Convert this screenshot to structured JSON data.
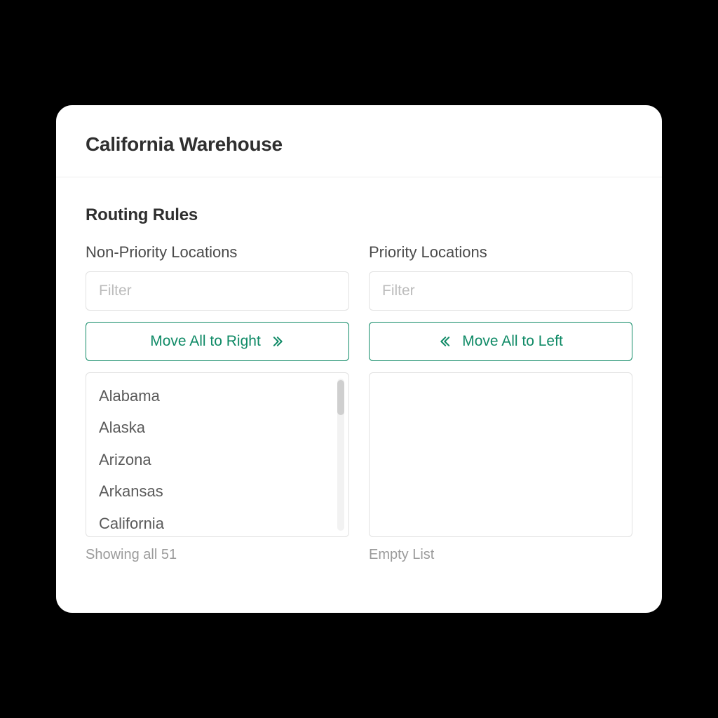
{
  "header": {
    "title": "California Warehouse"
  },
  "section": {
    "title": "Routing Rules"
  },
  "left": {
    "title": "Non-Priority Locations",
    "filter_placeholder": "Filter",
    "move_label": "Move All to Right",
    "items": [
      "Alabama",
      "Alaska",
      "Arizona",
      "Arkansas",
      "California"
    ],
    "status": "Showing all 51"
  },
  "right": {
    "title": "Priority Locations",
    "filter_placeholder": "Filter",
    "move_label": "Move All to Left",
    "status": "Empty List"
  },
  "colors": {
    "accent": "#0f8a66"
  }
}
